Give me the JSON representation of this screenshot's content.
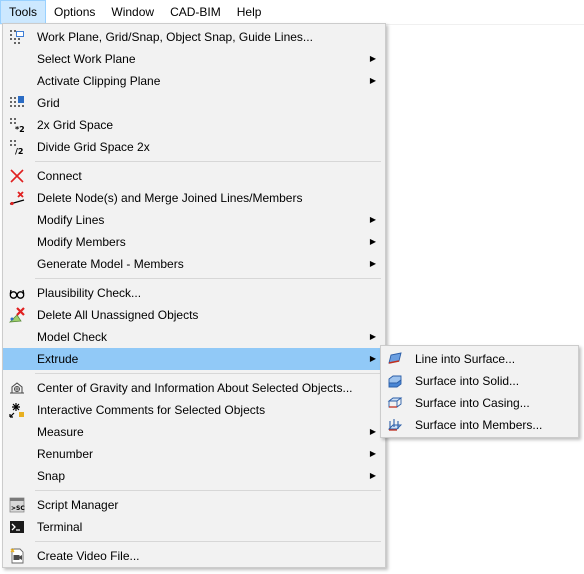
{
  "menubar": {
    "items": [
      {
        "label": "Tools",
        "active": true
      },
      {
        "label": "Options"
      },
      {
        "label": "Window"
      },
      {
        "label": "CAD-BIM"
      },
      {
        "label": "Help"
      }
    ]
  },
  "tools_menu": {
    "items": [
      {
        "label": "Work Plane, Grid/Snap, Object Snap, Guide Lines...",
        "icon": "work-plane-icon"
      },
      {
        "label": "Select Work Plane",
        "submenu": true
      },
      {
        "label": "Activate Clipping Plane",
        "submenu": true
      },
      {
        "label": "Grid",
        "icon": "grid-icon"
      },
      {
        "label": "2x Grid Space",
        "icon": "grid-double-icon"
      },
      {
        "label": "Divide Grid Space 2x",
        "icon": "grid-divide-icon"
      },
      {
        "label": "Connect",
        "icon": "connect-icon"
      },
      {
        "label": "Delete Node(s) and Merge Joined Lines/Members",
        "icon": "delete-node-icon"
      },
      {
        "label": "Modify Lines",
        "submenu": true
      },
      {
        "label": "Modify Members",
        "submenu": true
      },
      {
        "label": "Generate Model - Members",
        "submenu": true
      },
      {
        "label": "Plausibility Check...",
        "icon": "glasses-icon"
      },
      {
        "label": "Delete All Unassigned Objects",
        "icon": "delete-unassigned-icon"
      },
      {
        "label": "Model Check",
        "submenu": true
      },
      {
        "label": "Extrude",
        "submenu": true,
        "highlighted": true
      },
      {
        "label": "Center of Gravity and Information About Selected Objects...",
        "icon": "center-of-gravity-icon"
      },
      {
        "label": "Interactive Comments for Selected Objects",
        "icon": "comments-icon"
      },
      {
        "label": "Measure",
        "submenu": true
      },
      {
        "label": "Renumber",
        "submenu": true
      },
      {
        "label": "Snap",
        "submenu": true
      },
      {
        "label": "Script Manager",
        "icon": "script-manager-icon"
      },
      {
        "label": "Terminal",
        "icon": "terminal-icon"
      },
      {
        "label": "Create Video File...",
        "icon": "video-file-icon"
      }
    ]
  },
  "extrude_submenu": {
    "items": [
      {
        "label": "Line into Surface...",
        "icon": "line-into-surface-icon"
      },
      {
        "label": "Surface into Solid...",
        "icon": "surface-into-solid-icon"
      },
      {
        "label": "Surface into Casing...",
        "icon": "surface-into-casing-icon"
      },
      {
        "label": "Surface into Members...",
        "icon": "surface-into-members-icon"
      }
    ]
  },
  "colors": {
    "highlight": "#91c9f7",
    "menu_bg": "#f2f2f2",
    "accent_red": "#e02020",
    "accent_blue": "#2b6cc4"
  }
}
